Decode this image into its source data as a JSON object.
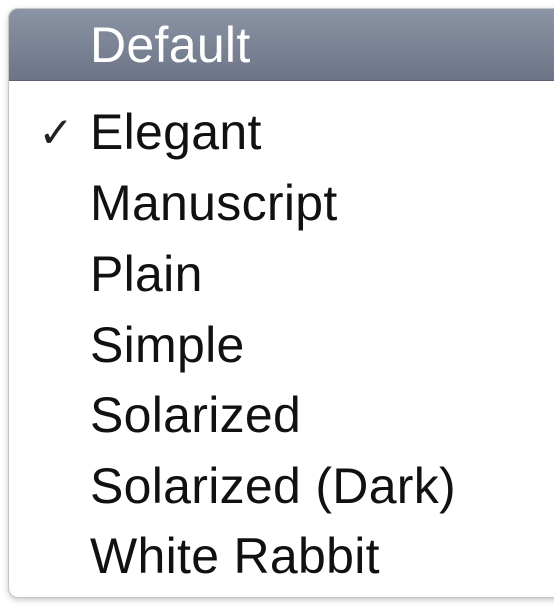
{
  "menu": {
    "items": [
      {
        "label": "Default",
        "checked": false,
        "highlighted": true
      },
      {
        "label": "Elegant",
        "checked": true,
        "highlighted": false
      },
      {
        "label": "Manuscript",
        "checked": false,
        "highlighted": false
      },
      {
        "label": "Plain",
        "checked": false,
        "highlighted": false
      },
      {
        "label": "Simple",
        "checked": false,
        "highlighted": false
      },
      {
        "label": "Solarized",
        "checked": false,
        "highlighted": false
      },
      {
        "label": "Solarized (Dark)",
        "checked": false,
        "highlighted": false
      },
      {
        "label": "White Rabbit",
        "checked": false,
        "highlighted": false
      }
    ],
    "checkmark_icon": "checkmark-icon",
    "highlight_color": "#7d8698"
  }
}
